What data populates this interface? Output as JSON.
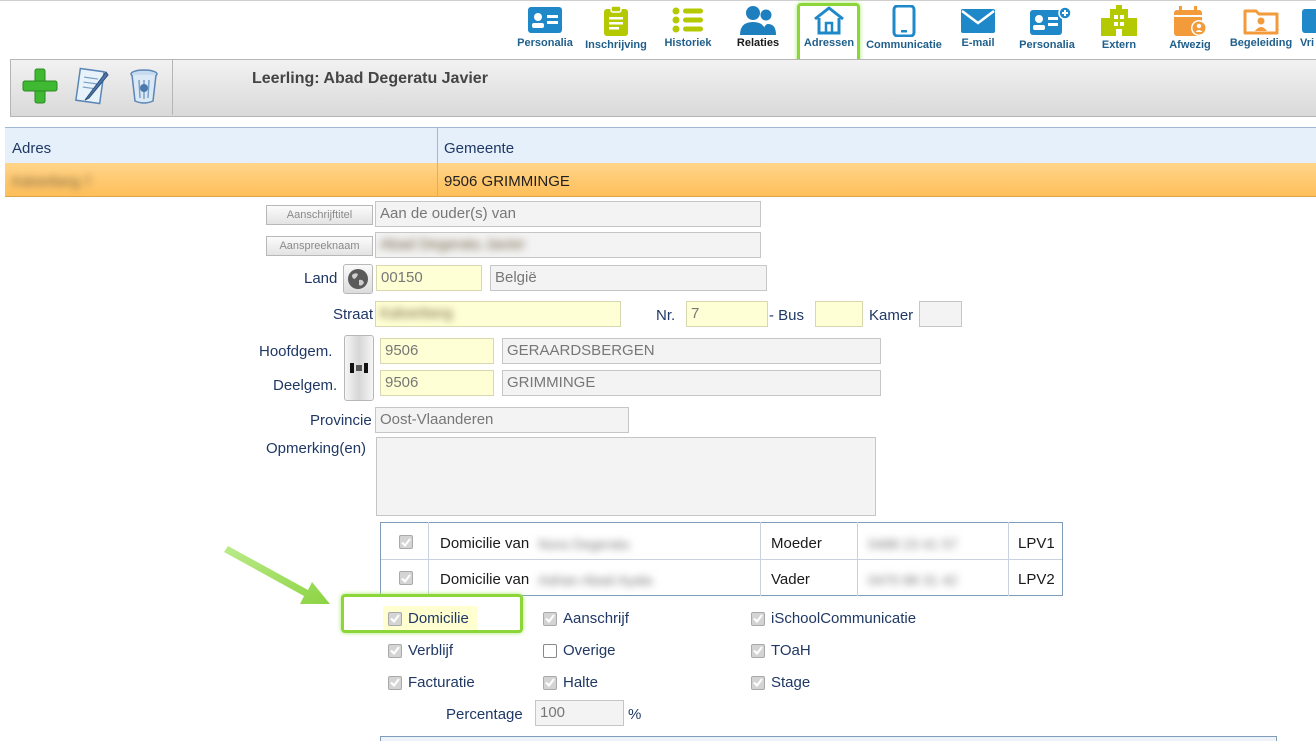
{
  "nav": {
    "items": [
      {
        "label": "Personalia",
        "icon": "id-card-icon",
        "color": "#1e88c9"
      },
      {
        "label": "Inschrijving",
        "icon": "clipboard-icon",
        "color": "#b5c900"
      },
      {
        "label": "Historiek",
        "icon": "list-icon",
        "color": "#b5c900"
      },
      {
        "label": "Relaties",
        "icon": "users-icon",
        "color": "#1e7fbf"
      },
      {
        "label": "Adressen",
        "icon": "home-icon",
        "color": "#1e88c9"
      },
      {
        "label": "Communicatie",
        "icon": "phone-icon",
        "color": "#1e88c9"
      },
      {
        "label": "E-mail",
        "icon": "mail-icon",
        "color": "#1e88c9"
      },
      {
        "label": "Personalia",
        "icon": "id-card-plus-icon",
        "color": "#1e88c9"
      },
      {
        "label": "Extern",
        "icon": "building-icon",
        "color": "#b5c900"
      },
      {
        "label": "Afwezig",
        "icon": "calendar-user-icon",
        "color": "#f39a3b"
      },
      {
        "label": "Begeleiding",
        "icon": "folder-user-icon",
        "color": "#f39a3b"
      },
      {
        "label": "Vri",
        "icon": "partial-icon",
        "color": "#1e88c9"
      }
    ]
  },
  "toolbar": {
    "student_title": "Leerling: Abad Degeratu  Javier"
  },
  "grid": {
    "headers": [
      "Adres",
      "Gemeente"
    ],
    "row": {
      "adres": "Kalverberg 7",
      "gemeente": "9506 GRIMMINGE"
    }
  },
  "form": {
    "aanschrijftitel_btn": "Aanschrijftitel",
    "aanschrijftitel_value": "Aan de ouder(s) van",
    "aanspreeknaam_btn": "Aanspreeknaam",
    "aanspreeknaam_value": "Abad Degeratu Javier",
    "land_label": "Land",
    "land_code": "00150",
    "land_name": "België",
    "straat_label": "Straat",
    "straat_value": "Kalverberg",
    "nr_label": "Nr.",
    "nr_value": "7",
    "bus_label": "- Bus",
    "bus_value": "",
    "kamer_label": "Kamer",
    "kamer_value": "",
    "hoofdgem_label": "Hoofdgem.",
    "hoofdgem_code": "9506",
    "hoofdgem_name": "GERAARDSBERGEN",
    "deelgem_label": "Deelgem.",
    "deelgem_code": "9506",
    "deelgem_name": "GRIMMINGE",
    "provincie_label": "Provincie",
    "provincie_value": "Oost-Vlaanderen",
    "opmerking_label": "Opmerking(en)",
    "opmerking_value": ""
  },
  "domicile": [
    {
      "text": "Domicilie van",
      "name": "Nora Degeratu",
      "relation": "Moeder",
      "phone": "0488 23 41 57",
      "code": "LPV1"
    },
    {
      "text": "Domicilie van",
      "name": "Adrian Abad Ayala",
      "relation": "Vader",
      "phone": "0470 88 31 42",
      "code": "LPV2"
    }
  ],
  "checks": {
    "col1": [
      {
        "label": "Domicilie",
        "checked": true
      },
      {
        "label": "Verblijf",
        "checked": true
      },
      {
        "label": "Facturatie",
        "checked": true
      }
    ],
    "col2": [
      {
        "label": "Aanschrijf",
        "checked": true
      },
      {
        "label": "Overige",
        "checked": false
      },
      {
        "label": "Halte",
        "checked": true
      }
    ],
    "col3": [
      {
        "label": "iSchoolCommunicatie",
        "checked": true
      },
      {
        "label": "TOaH",
        "checked": true
      },
      {
        "label": "Stage",
        "checked": true
      }
    ]
  },
  "percentage": {
    "label": "Percentage",
    "value": "100",
    "unit": "%"
  },
  "colors": {
    "highlight": "#8cd63a",
    "selected_row": "#ffc96e",
    "accent": "#1e88c9"
  }
}
